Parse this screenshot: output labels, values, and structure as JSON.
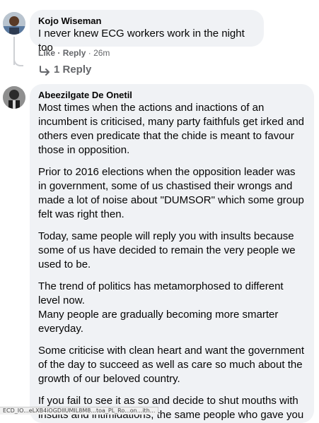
{
  "comment1": {
    "author": "Kojo Wiseman",
    "text": "I never knew ECG workers work in the night too",
    "like_label": "Like",
    "reply_label": "Reply",
    "separator": "·",
    "time": "26m",
    "replies_label": "1 Reply"
  },
  "comment2": {
    "author": "Abeezilgate De Onetil",
    "paragraphs": [
      "Most times when the actions and inactions of an incumbent is criticised, many party faithfuls get irked and others even predicate that the chide is meant to favour those in opposition.",
      "Prior to 2016 elections when the opposition leader was in government, some of us chastised their wrongs and made a lot of noise about \"DUMSOR\" which some group felt was right then.",
      "Today, same people will reply you with insults because some of us have decided to remain the very people we used to be.",
      "The trend of politics has metamorphosed to different level now.\nMany people are gradually becoming more smarter everyday.",
      "Some criticise with clean heart and want the government of the day to succeed as well as care so much about the growth of our beloved country.",
      "If you fail to see it as so and decide to shut mouths with insults and intimidations, the same people who gave you"
    ]
  },
  "status_bar": {
    "url": "ECD_IO...eLXB4iOGDlIUMIL8M8...toa_PL_Ro...on...ith..."
  }
}
